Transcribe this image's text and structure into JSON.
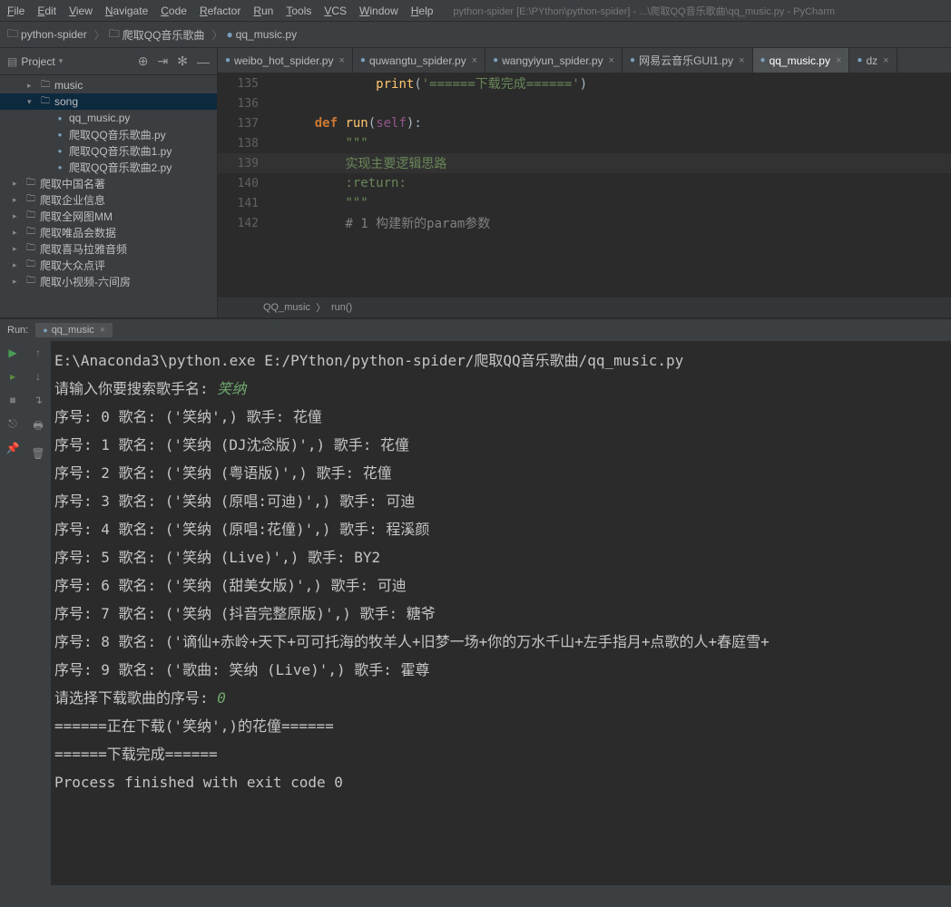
{
  "window_title": "python-spider [E:\\PYthon\\python-spider] - ...\\爬取QQ音乐歌曲\\qq_music.py - PyCharm",
  "menu": [
    "File",
    "Edit",
    "View",
    "Navigate",
    "Code",
    "Refactor",
    "Run",
    "Tools",
    "VCS",
    "Window",
    "Help"
  ],
  "breadcrumbs": [
    "python-spider",
    "爬取QQ音乐歌曲",
    "qq_music.py"
  ],
  "project_panel": {
    "title": "Project",
    "items": [
      {
        "indent": 1,
        "arrow": "▸",
        "type": "folder",
        "label": "music"
      },
      {
        "indent": 1,
        "arrow": "▾",
        "type": "folder",
        "label": "song",
        "selected": true
      },
      {
        "indent": 2,
        "arrow": "",
        "type": "py",
        "label": "qq_music.py"
      },
      {
        "indent": 2,
        "arrow": "",
        "type": "py",
        "label": "爬取QQ音乐歌曲.py"
      },
      {
        "indent": 2,
        "arrow": "",
        "type": "py",
        "label": "爬取QQ音乐歌曲1.py"
      },
      {
        "indent": 2,
        "arrow": "",
        "type": "py",
        "label": "爬取QQ音乐歌曲2.py"
      },
      {
        "indent": 0,
        "arrow": "▸",
        "type": "folder",
        "label": "爬取中国名著"
      },
      {
        "indent": 0,
        "arrow": "▸",
        "type": "folder",
        "label": "爬取企业信息"
      },
      {
        "indent": 0,
        "arrow": "▸",
        "type": "folder",
        "label": "爬取全网图MM"
      },
      {
        "indent": 0,
        "arrow": "▸",
        "type": "folder",
        "label": "爬取唯品会数据"
      },
      {
        "indent": 0,
        "arrow": "▸",
        "type": "folder",
        "label": "爬取喜马拉雅音频"
      },
      {
        "indent": 0,
        "arrow": "▸",
        "type": "folder",
        "label": "爬取大众点评"
      },
      {
        "indent": 0,
        "arrow": "▸",
        "type": "folder",
        "label": "爬取小视频-六间房"
      }
    ]
  },
  "tabs": [
    {
      "label": "weibo_hot_spider.py",
      "icon": "py"
    },
    {
      "label": "quwangtu_spider.py",
      "icon": "py"
    },
    {
      "label": "wangyiyun_spider.py",
      "icon": "py"
    },
    {
      "label": "网易云音乐GUI1.py",
      "icon": "py"
    },
    {
      "label": "qq_music.py",
      "icon": "py",
      "active": true
    },
    {
      "label": "dz",
      "icon": "py"
    }
  ],
  "code": {
    "lines": [
      {
        "n": 135,
        "html": "            <span class='k-fn'>print</span>(<span class='k-str'>'======下载完成======'</span>)"
      },
      {
        "n": 136,
        "html": ""
      },
      {
        "n": 137,
        "html": "    <span class='k-def'>def</span> <span class='k-fn'>run</span>(<span class='k-self'>self</span>):"
      },
      {
        "n": 138,
        "html": "        <span class='k-doc'>\"\"\"</span>"
      },
      {
        "n": 139,
        "html": "        <span class='k-doc'>实现主要逻辑思路</span>",
        "hl": true
      },
      {
        "n": 140,
        "html": "        <span class='k-doc'>:return:</span>"
      },
      {
        "n": 141,
        "html": "        <span class='k-doc'>\"\"\"</span>"
      },
      {
        "n": 142,
        "html": "        <span class='k-comment'># 1 构建新的param参数</span>"
      }
    ],
    "breadcrumb": [
      "QQ_music",
      "run()"
    ]
  },
  "run": {
    "label": "Run:",
    "tab": "qq_music",
    "console": [
      {
        "t": "E:\\Anaconda3\\python.exe E:/PYthon/python-spider/爬取QQ音乐歌曲/qq_music.py"
      },
      {
        "t": "请输入你要搜索歌手名: ",
        "input": "笑纳"
      },
      {
        "t": "序号: 0 歌名: ('笑纳',) 歌手: 花僮"
      },
      {
        "t": "序号: 1 歌名: ('笑纳 (DJ沈念版)',) 歌手: 花僮"
      },
      {
        "t": "序号: 2 歌名: ('笑纳 (粤语版)',) 歌手: 花僮"
      },
      {
        "t": "序号: 3 歌名: ('笑纳 (原唱:可迪)',) 歌手: 可迪"
      },
      {
        "t": "序号: 4 歌名: ('笑纳 (原唱:花僮)',) 歌手: 程溪颜"
      },
      {
        "t": "序号: 5 歌名: ('笑纳 (Live)',) 歌手: BY2"
      },
      {
        "t": "序号: 6 歌名: ('笑纳 (甜美女版)',) 歌手: 可迪"
      },
      {
        "t": "序号: 7 歌名: ('笑纳 (抖音完整原版)',) 歌手: 糖爷"
      },
      {
        "t": "序号: 8 歌名: ('谪仙+赤岭+天下+可可托海的牧羊人+旧梦一场+你的万水千山+左手指月+点歌的人+春庭雪+"
      },
      {
        "t": "序号: 9 歌名: ('歌曲: 笑纳 (Live)',) 歌手: 霍尊"
      },
      {
        "t": "请选择下载歌曲的序号: ",
        "input": "0"
      },
      {
        "t": "======正在下载('笑纳',)的花僮======"
      },
      {
        "t": "======下载完成======"
      },
      {
        "t": ""
      },
      {
        "t": "Process finished with exit code 0"
      }
    ]
  }
}
